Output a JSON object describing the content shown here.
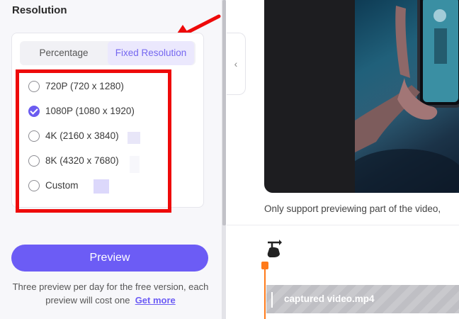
{
  "panel": {
    "title": "Resolution",
    "tabs": [
      {
        "label": "Percentage",
        "active": false
      },
      {
        "label": "Fixed Resolution",
        "active": true
      }
    ],
    "options": [
      {
        "label": "720P (720 x 1280)",
        "checked": false
      },
      {
        "label": "1080P (1080 x 1920)",
        "checked": true
      },
      {
        "label": "4K (2160 x 3840)",
        "checked": false
      },
      {
        "label": "8K (4320 x 7680)",
        "checked": false
      },
      {
        "label": "Custom",
        "checked": false
      }
    ],
    "preview_button": "Preview",
    "note_text": "Three preview per day for the free version, each preview will cost one",
    "note_link": "Get more"
  },
  "preview": {
    "collapse_icon": "‹",
    "caption": "Only support previewing part of the video,"
  },
  "timeline": {
    "track_label": "captured video.mp4"
  },
  "colors": {
    "accent": "#6c5cf5",
    "highlight_frame": "#ee0a0a",
    "playhead": "#ff7a1a"
  }
}
